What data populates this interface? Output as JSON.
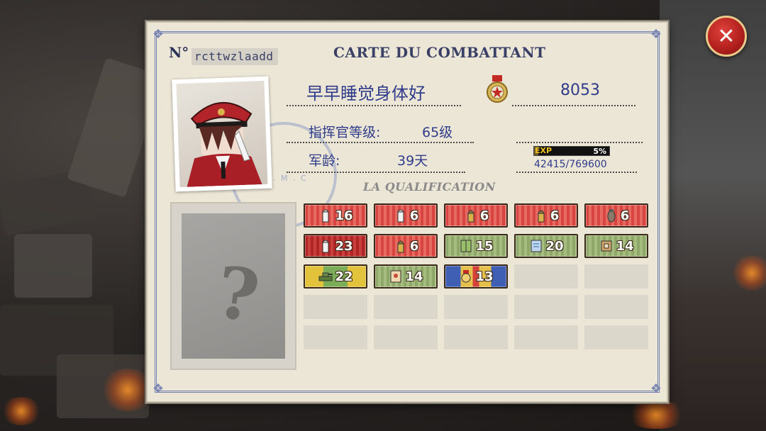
{
  "window": {
    "close_icon": "close-icon",
    "close_glyph": "✕",
    "accent_color": "#b01f1c"
  },
  "card": {
    "no_label": "N°",
    "player_id": "rcttwzlaadd",
    "title": "CARTE DU COMBATTANT",
    "commander_name": "早早睡觉身体好",
    "score_icon": "medal-icon",
    "score": "8053",
    "level_label": "指挥官等级:",
    "level_value": "65级",
    "service_label": "军龄:",
    "service_value": "39天",
    "exp": {
      "label": "EXP",
      "percent_text": "5%",
      "progress": "42415/769600",
      "fraction": 0.055
    },
    "stamp_text": "A . M . C",
    "unknown_glyph": "?"
  },
  "qualification": {
    "title": "LA QUALIFICATION",
    "badges": [
      {
        "icon": "ammo-icon",
        "count": "16",
        "theme": "red"
      },
      {
        "icon": "ammo-icon",
        "count": "6",
        "theme": "red"
      },
      {
        "icon": "shell-icon",
        "count": "6",
        "theme": "red"
      },
      {
        "icon": "shell-icon",
        "count": "6",
        "theme": "red"
      },
      {
        "icon": "bomb-icon",
        "count": "6",
        "theme": "red"
      },
      {
        "icon": "ammo-icon",
        "count": "23",
        "theme": "darkred"
      },
      {
        "icon": "shell-icon",
        "count": "6",
        "theme": "red"
      },
      {
        "icon": "book-icon",
        "count": "15",
        "theme": "green"
      },
      {
        "icon": "map-icon",
        "count": "20",
        "theme": "green"
      },
      {
        "icon": "crate-icon",
        "count": "14",
        "theme": "green"
      },
      {
        "icon": "tank-icon",
        "count": "22",
        "theme": "yellowgreen"
      },
      {
        "icon": "portrait-icon",
        "count": "14",
        "theme": "green"
      },
      {
        "icon": "medal-icon",
        "count": "13",
        "theme": "blueyellow"
      }
    ]
  }
}
